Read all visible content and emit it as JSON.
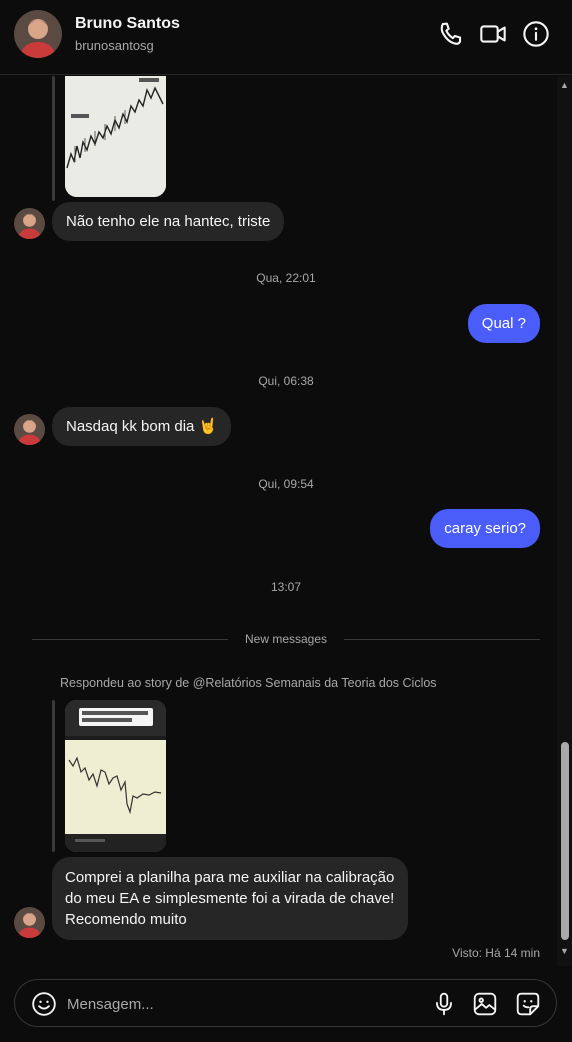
{
  "header": {
    "name": "Bruno Santos",
    "username": "brunosantosg"
  },
  "icons": {
    "call": "phone-icon",
    "video": "video-camera-icon",
    "info": "info-icon",
    "emoji": "emoji-icon",
    "mic": "microphone-icon",
    "gallery": "image-icon",
    "sticker": "sticker-icon"
  },
  "messages": {
    "m1": "Não tenho ele na hantec, triste",
    "ts1": "Qua, 22:01",
    "m2": "Qual ?",
    "ts2": "Qui, 06:38",
    "m3": "Nasdaq kk bom dia 🤘",
    "ts3": "Qui, 09:54",
    "m4": "caray serio?",
    "ts4": "13:07",
    "divider": "New messages",
    "story_reply": "Respondeu ao story de @Relatórios Semanais da Teoria dos Ciclos",
    "m5_line1": "Comprei a planilha para me auxiliar na calibração",
    "m5_line2": "do meu EA e simplesmente foi a virada de chave!",
    "m5_line3": "Recomendo muito",
    "seen": "Visto: Há 14 min"
  },
  "composer": {
    "placeholder": "Mensagem..."
  },
  "colors": {
    "background": "#0c0c0d",
    "incoming_bubble": "#262626",
    "outgoing_bubble": "#4a5df9",
    "secondary_text": "#a8a8a8"
  }
}
